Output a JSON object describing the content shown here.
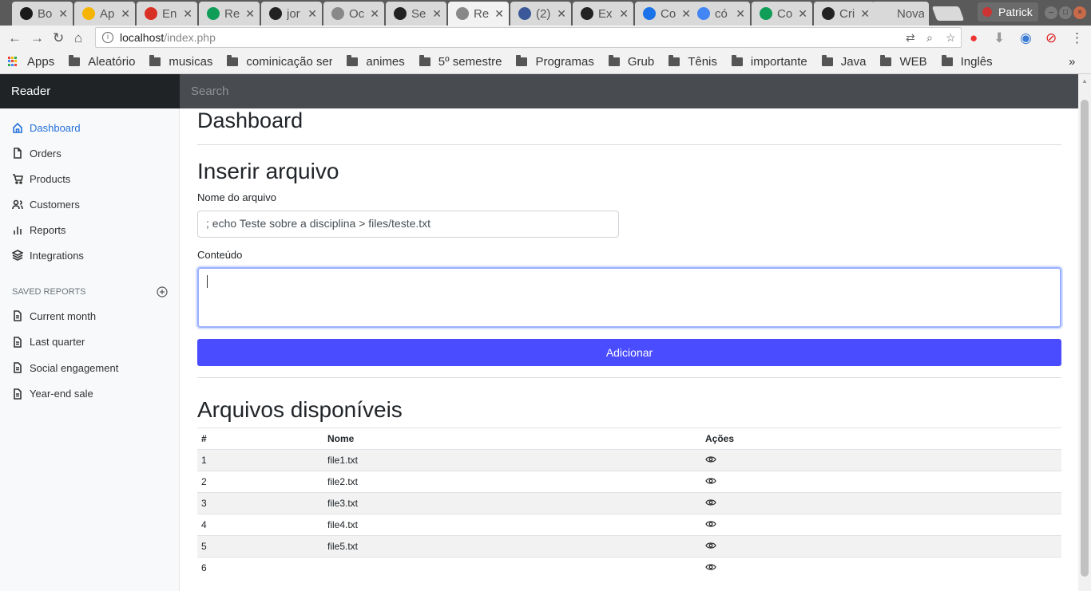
{
  "browser": {
    "tabs": [
      {
        "label": "Bo",
        "color": "#1a1a1a"
      },
      {
        "label": "Ap",
        "color": "#f4b400"
      },
      {
        "label": "En",
        "color": "#d93025"
      },
      {
        "label": "Re",
        "color": "#0f9d58"
      },
      {
        "label": "jor",
        "color": "#222"
      },
      {
        "label": "Oc",
        "color": "#888"
      },
      {
        "label": "Se",
        "color": "#222"
      },
      {
        "label": "Re",
        "color": "#888"
      },
      {
        "label": "(2)",
        "color": "#3b5998"
      },
      {
        "label": "Ex",
        "color": "#222"
      },
      {
        "label": "Co",
        "color": "#1a73e8"
      },
      {
        "label": "có",
        "color": "#4285f4"
      },
      {
        "label": "Co",
        "color": "#0f9d58"
      },
      {
        "label": "Cri",
        "color": "#222"
      },
      {
        "label": "Nova",
        "color": "#d9d9d9"
      }
    ],
    "active_tab": 7,
    "profile_name": "Patrick",
    "url_host": "localhost",
    "url_path": "/index.php",
    "bookmarks": [
      "Apps",
      "Aleatório",
      "musicas",
      "cominicação ser",
      "animes",
      "5º semestre",
      "Programas",
      "Grub",
      "Tênis",
      "importante",
      "Java",
      "WEB",
      "Inglês"
    ],
    "bookmarks_more": "»"
  },
  "app": {
    "brand": "Reader",
    "search_placeholder": "Search"
  },
  "sidebar": {
    "items": [
      {
        "label": "Dashboard",
        "icon": "home-icon",
        "active": true
      },
      {
        "label": "Orders",
        "icon": "file-icon"
      },
      {
        "label": "Products",
        "icon": "cart-icon"
      },
      {
        "label": "Customers",
        "icon": "users-icon"
      },
      {
        "label": "Reports",
        "icon": "bar-chart-icon"
      },
      {
        "label": "Integrations",
        "icon": "layers-icon"
      }
    ],
    "saved_reports_heading": "SAVED REPORTS",
    "saved_reports": [
      "Current month",
      "Last quarter",
      "Social engagement",
      "Year-end sale"
    ]
  },
  "main": {
    "title": "Dashboard",
    "form": {
      "heading": "Inserir arquivo",
      "filename_label": "Nome do arquivo",
      "filename_value": "; echo Teste sobre a disciplina > files/teste.txt",
      "content_label": "Conteúdo",
      "content_value": "",
      "submit_label": "Adicionar"
    },
    "files": {
      "heading": "Arquivos disponíveis",
      "columns": [
        "#",
        "Nome",
        "Ações"
      ],
      "rows": [
        {
          "id": "1",
          "name": "file1.txt"
        },
        {
          "id": "2",
          "name": "file2.txt"
        },
        {
          "id": "3",
          "name": "file3.txt"
        },
        {
          "id": "4",
          "name": "file4.txt"
        },
        {
          "id": "5",
          "name": "file5.txt"
        },
        {
          "id": "6",
          "name": ""
        }
      ]
    }
  },
  "colors": {
    "accent": "#4a4cff",
    "sidebar_active": "#2470dc",
    "topbar": "#343a40"
  }
}
